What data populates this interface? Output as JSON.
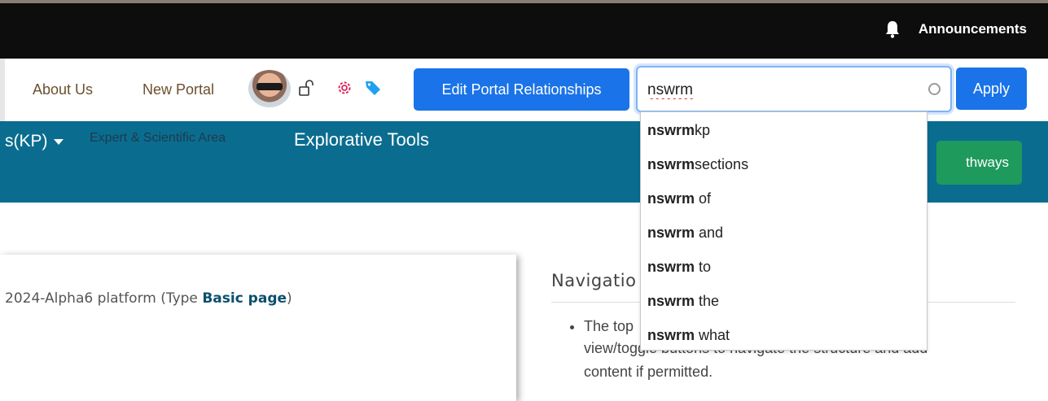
{
  "topbar": {
    "announcements_label": "Announcements"
  },
  "header": {
    "links": [
      "About Us",
      "New Portal"
    ],
    "edit_button": "Edit Portal Relationships",
    "search": {
      "value": "nswrm"
    },
    "apply_button": "Apply"
  },
  "band": {
    "kp_label": "s(KP)",
    "expert_label": "Expert & Scientific Area",
    "explorative_label": "Explorative Tools",
    "pathways_label": "thways"
  },
  "content": {
    "platform_prefix": "2024-Alpha6 platform (Type ",
    "platform_type": "Basic page",
    "platform_suffix": ")",
    "nav_heading": "Navigatio",
    "nav_line1": "The top",
    "nav_line2": "view/toggle buttons to navigate the structure and add",
    "nav_line3": "content if permitted."
  },
  "suggestions": [
    {
      "bold": "nswrm",
      "rest": "kp"
    },
    {
      "bold": "nswrm",
      "rest": "sections"
    },
    {
      "bold": "nswrm",
      "rest": " of"
    },
    {
      "bold": "nswrm",
      "rest": " and"
    },
    {
      "bold": "nswrm",
      "rest": " to"
    },
    {
      "bold": "nswrm",
      "rest": " the"
    },
    {
      "bold": "nswrm",
      "rest": " what"
    }
  ],
  "icons": {
    "bell": "bell-icon",
    "lock": "unlock-icon",
    "gear": "gear-icon",
    "tag": "tag-icon"
  },
  "colors": {
    "band": "#0a6d90",
    "primary": "#1a73e8",
    "pathways": "#1e9a5c",
    "gear": "#e0245e",
    "tag": "#1ea1f2"
  }
}
